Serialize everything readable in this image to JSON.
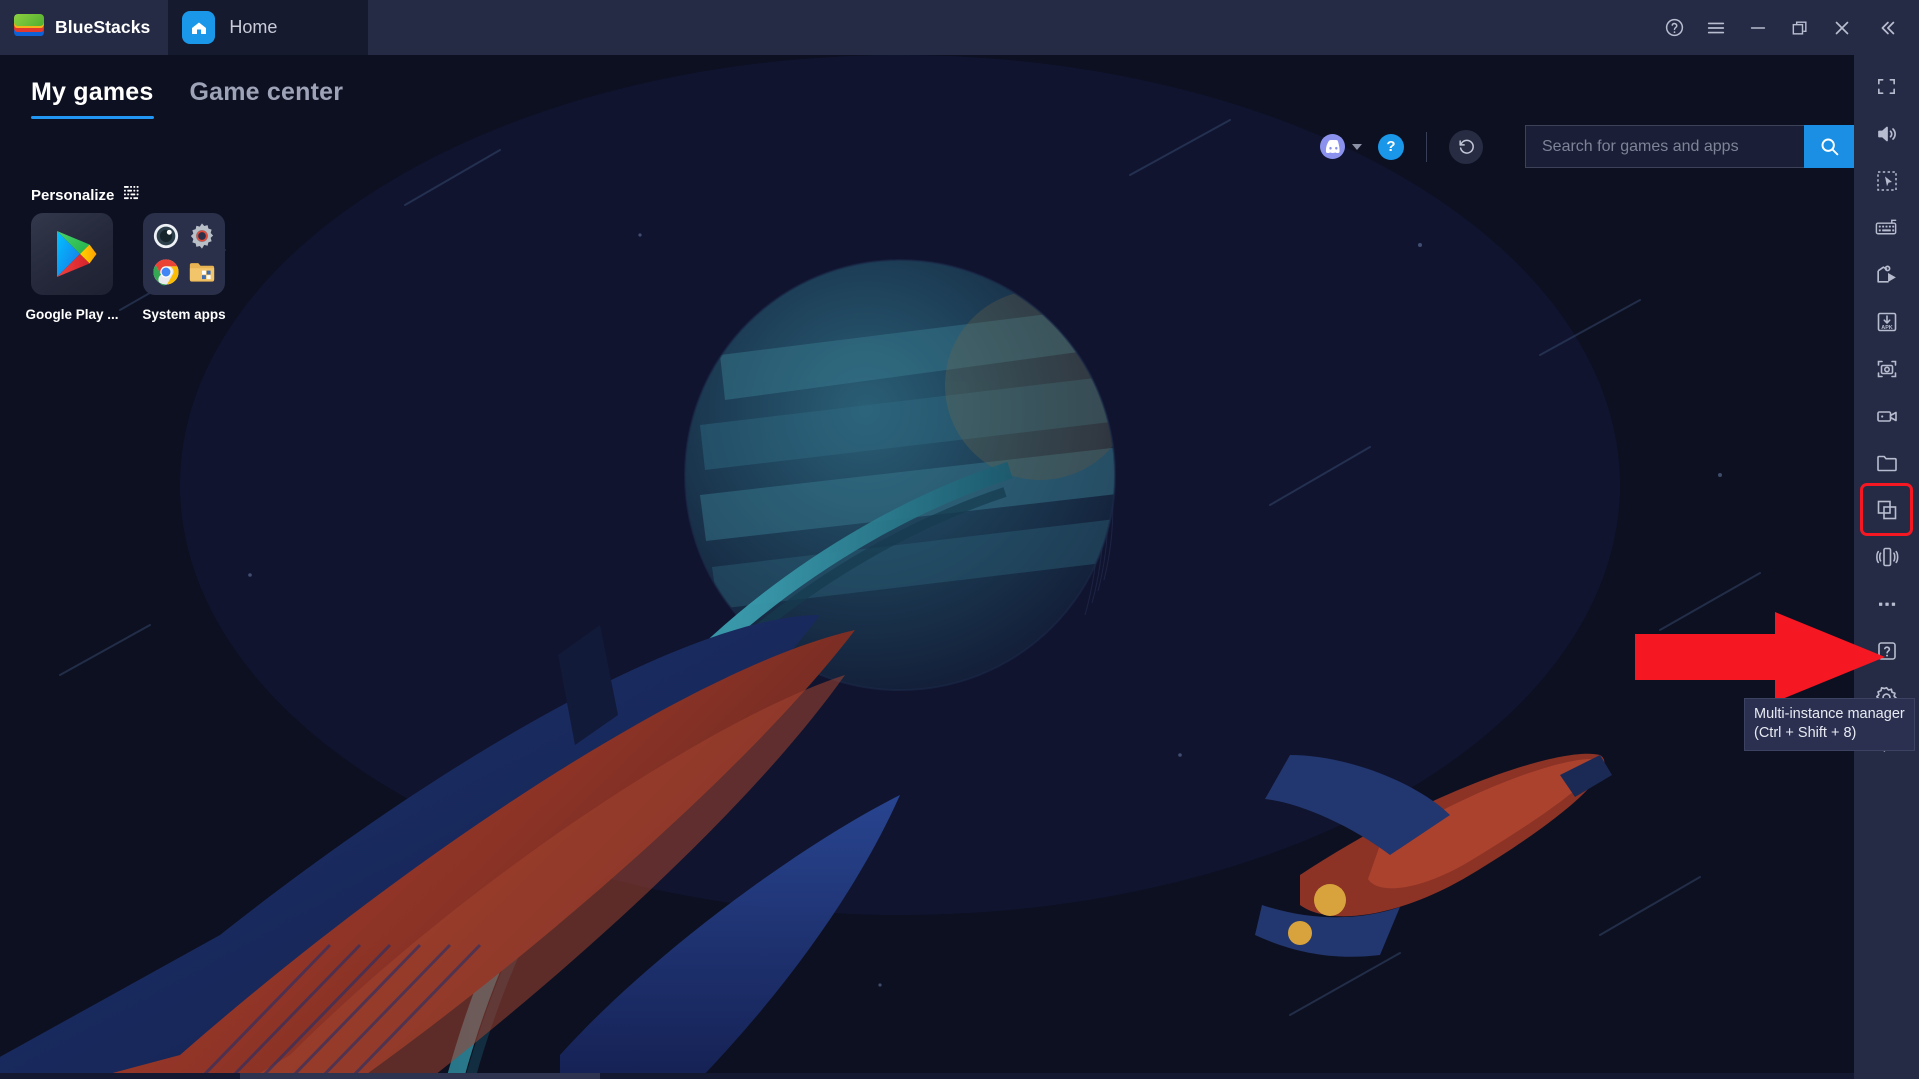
{
  "titlebar": {
    "brand": "BlueStacks",
    "tab_label": "Home",
    "tab_icon": "home-icon",
    "controls": [
      {
        "name": "help-circle-icon",
        "label": "?"
      },
      {
        "name": "hamburger-menu-icon",
        "label": "Menu"
      },
      {
        "name": "minimize-icon",
        "label": "Minimize"
      },
      {
        "name": "restore-window-icon",
        "label": "Restore"
      },
      {
        "name": "close-icon",
        "label": "Close"
      },
      {
        "name": "collapse-left-icon",
        "label": "Collapse"
      }
    ]
  },
  "tabs": [
    {
      "label": "My games",
      "active": true
    },
    {
      "label": "Game center",
      "active": false
    }
  ],
  "personalize": {
    "label": "Personalize",
    "icon": "layout-grid-icon"
  },
  "topbar": {
    "discord_icon": "discord-icon",
    "dropdown_icon": "chevron-down-icon",
    "help_label": "?",
    "refresh_icon": "rotate-ccw-icon"
  },
  "search": {
    "placeholder": "Search for games and apps",
    "value": "",
    "button_icon": "search-icon"
  },
  "apps": [
    {
      "name": "google-play-store",
      "label": "Google Play ...",
      "icon": "google-play-icon"
    },
    {
      "name": "system-apps-folder",
      "label": "System apps",
      "icon": "folder-icon",
      "children": [
        "camera-icon",
        "settings-gear-icon",
        "chrome-icon",
        "file-manager-icon"
      ]
    }
  ],
  "toolbar": [
    {
      "name": "fullscreen-icon",
      "title": "Full screen"
    },
    {
      "name": "volume-icon",
      "title": "Volume"
    },
    {
      "name": "pointer-select-icon",
      "title": "Game controls"
    },
    {
      "name": "keyboard-controls-icon",
      "title": "Keyboard controls"
    },
    {
      "name": "macro-recorder-icon",
      "title": "Macro recorder"
    },
    {
      "name": "install-apk-icon",
      "title": "Install APK"
    },
    {
      "name": "screenshot-icon",
      "title": "Screenshot"
    },
    {
      "name": "record-video-icon",
      "title": "Record screen"
    },
    {
      "name": "media-folder-icon",
      "title": "Media manager"
    },
    {
      "name": "multi-instance-icon",
      "title": "Multi-instance manager",
      "highlighted": true
    },
    {
      "name": "shake-device-icon",
      "title": "Shake"
    },
    {
      "name": "more-options-icon",
      "title": "More"
    },
    {
      "name": "help-square-icon",
      "title": "Help"
    },
    {
      "name": "settings-gear-icon",
      "title": "Settings"
    },
    {
      "name": "back-arrow-icon",
      "title": "Back"
    }
  ],
  "tooltip": {
    "title": "Multi-instance manager",
    "shortcut": "(Ctrl + Shift + 8)"
  },
  "colors": {
    "accent_blue": "#1a8fe3",
    "titlebar": "#262b45",
    "stage_bg": "#0d1021",
    "highlight_red": "#f51722",
    "tab_underline": "#2196f3"
  }
}
